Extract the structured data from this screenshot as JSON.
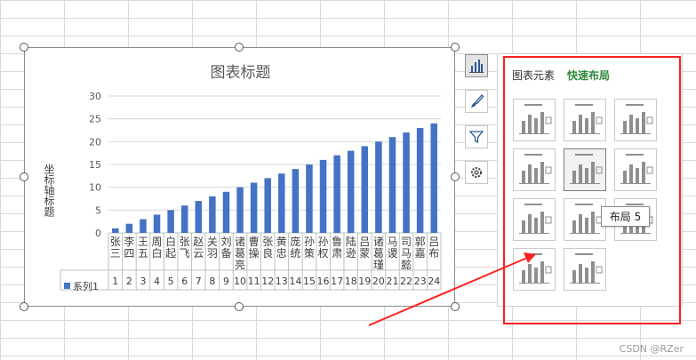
{
  "chart": {
    "title": "图表标题",
    "y_axis_title": "坐标轴标题",
    "legend_label": "系列1"
  },
  "chart_data": {
    "type": "bar",
    "title": "图表标题",
    "ylabel": "坐标轴标题",
    "xlabel": "",
    "ylim": [
      0,
      30
    ],
    "yticks": [
      0,
      5,
      10,
      15,
      20,
      25,
      30
    ],
    "categories": [
      "张三",
      "李四",
      "王五",
      "周白",
      "白起",
      "张飞",
      "赵云",
      "关羽",
      "刘备",
      "诸葛亮",
      "曹操",
      "张良",
      "黄忠",
      "庞统",
      "孙策",
      "孙权",
      "鲁肃",
      "陆逊",
      "吕蒙",
      "诸葛瑾",
      "马谡",
      "司马懿",
      "郭嘉",
      "吕布"
    ],
    "series": [
      {
        "name": "系列1",
        "values": [
          1,
          2,
          3,
          4,
          5,
          6,
          7,
          8,
          9,
          10,
          11,
          12,
          13,
          14,
          15,
          16,
          17,
          18,
          19,
          20,
          21,
          22,
          23,
          24
        ]
      }
    ],
    "grid": true,
    "legend": "bottom-left",
    "bar_color": "#4472c4"
  },
  "panel": {
    "tab_elements": "图表元素",
    "tab_quick_layout": "快速布局",
    "tooltip": "布局 5"
  },
  "colors": {
    "accent_green": "#2e8b3a",
    "highlight_red": "#ff2020",
    "bar": "#4472c4"
  },
  "side_buttons": [
    "chart-layout-icon",
    "brush-icon",
    "filter-icon",
    "gear-icon"
  ],
  "watermark": "CSDN @RZer"
}
